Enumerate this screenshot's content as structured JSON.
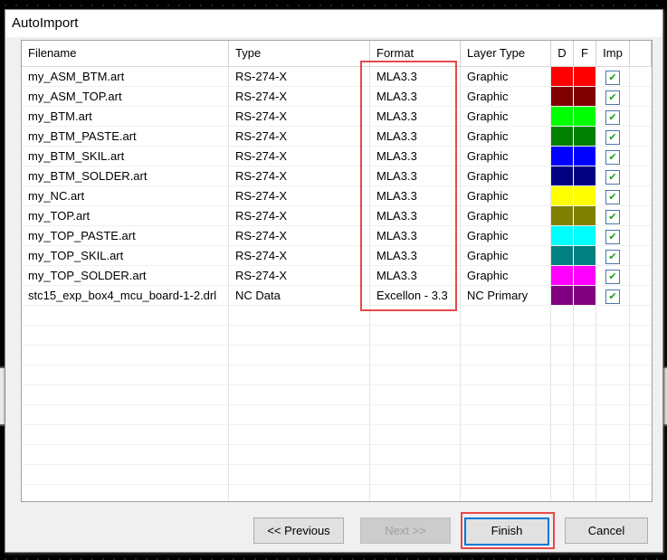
{
  "window": {
    "title": "AutoImport"
  },
  "table": {
    "headers": [
      "Filename",
      "Type",
      "Format",
      "Layer Type",
      "D",
      "F",
      "Imp"
    ],
    "rows": [
      {
        "filename": "my_ASM_BTM.art",
        "type": "RS-274-X",
        "format": "MLA3.3",
        "layer_type": "Graphic",
        "d_color": "#ff0000",
        "f_color": "#ff0000",
        "imp": true
      },
      {
        "filename": "my_ASM_TOP.art",
        "type": "RS-274-X",
        "format": "MLA3.3",
        "layer_type": "Graphic",
        "d_color": "#800000",
        "f_color": "#800000",
        "imp": true
      },
      {
        "filename": "my_BTM.art",
        "type": "RS-274-X",
        "format": "MLA3.3",
        "layer_type": "Graphic",
        "d_color": "#00ff00",
        "f_color": "#00ff00",
        "imp": true
      },
      {
        "filename": "my_BTM_PASTE.art",
        "type": "RS-274-X",
        "format": "MLA3.3",
        "layer_type": "Graphic",
        "d_color": "#008000",
        "f_color": "#008000",
        "imp": true
      },
      {
        "filename": "my_BTM_SKIL.art",
        "type": "RS-274-X",
        "format": "MLA3.3",
        "layer_type": "Graphic",
        "d_color": "#0000ff",
        "f_color": "#0000ff",
        "imp": true
      },
      {
        "filename": "my_BTM_SOLDER.art",
        "type": "RS-274-X",
        "format": "MLA3.3",
        "layer_type": "Graphic",
        "d_color": "#000080",
        "f_color": "#000080",
        "imp": true
      },
      {
        "filename": "my_NC.art",
        "type": "RS-274-X",
        "format": "MLA3.3",
        "layer_type": "Graphic",
        "d_color": "#ffff00",
        "f_color": "#ffff00",
        "imp": true
      },
      {
        "filename": "my_TOP.art",
        "type": "RS-274-X",
        "format": "MLA3.3",
        "layer_type": "Graphic",
        "d_color": "#808000",
        "f_color": "#808000",
        "imp": true
      },
      {
        "filename": "my_TOP_PASTE.art",
        "type": "RS-274-X",
        "format": "MLA3.3",
        "layer_type": "Graphic",
        "d_color": "#00ffff",
        "f_color": "#00ffff",
        "imp": true
      },
      {
        "filename": "my_TOP_SKIL.art",
        "type": "RS-274-X",
        "format": "MLA3.3",
        "layer_type": "Graphic",
        "d_color": "#008080",
        "f_color": "#008080",
        "imp": true
      },
      {
        "filename": "my_TOP_SOLDER.art",
        "type": "RS-274-X",
        "format": "MLA3.3",
        "layer_type": "Graphic",
        "d_color": "#ff00ff",
        "f_color": "#ff00ff",
        "imp": true
      },
      {
        "filename": "stc15_exp_box4_mcu_board-1-2.drl",
        "type": "NC Data",
        "format": "Excellon - 3.3",
        "layer_type": "NC Primary",
        "d_color": "#800080",
        "f_color": "#800080",
        "imp": true
      }
    ]
  },
  "buttons": {
    "previous": "<< Previous",
    "next": "Next >>",
    "finish": "Finish",
    "cancel": "Cancel"
  },
  "highlight_color": "#e84848"
}
